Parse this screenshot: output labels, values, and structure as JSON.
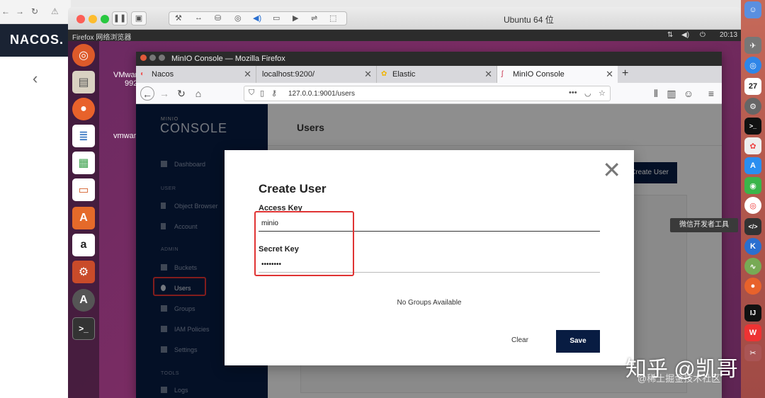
{
  "host": {
    "nacos_logo": "NACOS.",
    "back": "‹"
  },
  "vm": {
    "title": "Ubuntu 64 位"
  },
  "ubuntu": {
    "topbar_left": "Firefox 网络浏览器",
    "time": "20:13",
    "desktop_labels": [
      "VMwar",
      "992",
      "vmwar"
    ]
  },
  "firefox": {
    "window_title": "MinIO Console — Mozilla Firefox",
    "tabs": [
      {
        "label": "Nacos"
      },
      {
        "label": "localhost:9200/"
      },
      {
        "label": "Elastic"
      },
      {
        "label": "MinIO Console"
      }
    ],
    "url": "127.0.0.1:9001/users",
    "page_actions": "•••"
  },
  "minio": {
    "logo_small": "MINIO",
    "logo": "CONSOLE",
    "nav": {
      "dashboard": "Dashboard",
      "section_user": "USER",
      "object_browser": "Object Browser",
      "account": "Account",
      "section_admin": "ADMIN",
      "buckets": "Buckets",
      "users": "Users",
      "groups": "Groups",
      "iam_policies": "IAM Policies",
      "settings": "Settings",
      "section_tools": "TOOLS",
      "logs": "Logs"
    },
    "page_title": "Users",
    "create_user_button": "Create User"
  },
  "modal": {
    "title": "Create User",
    "access_key_label": "Access Key",
    "access_key_value": "minio",
    "secret_key_label": "Secret Key",
    "secret_key_value": "••••••••",
    "no_groups": "No Groups Available",
    "clear": "Clear",
    "save": "Save"
  },
  "mac_dock": {
    "calendar_day": "27",
    "tooltip": "微信开发者工具"
  },
  "watermark": {
    "main": "知乎 @凯哥",
    "sub": "@稀土掘金技术社区"
  },
  "colors": {
    "minio_navy": "#081c42",
    "highlight_red": "#e03333",
    "ubuntu_purple": "#7b2c63"
  }
}
